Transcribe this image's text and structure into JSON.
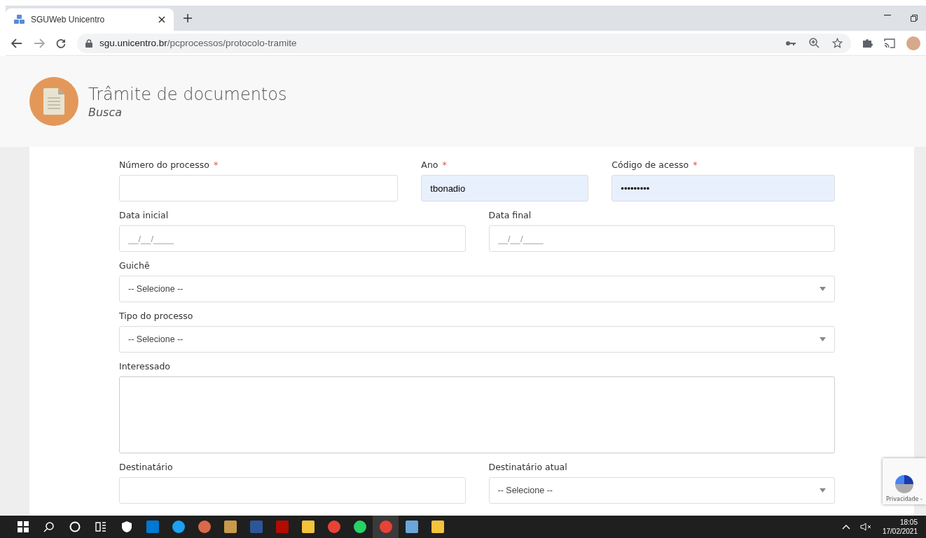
{
  "browser": {
    "tab_title": "SGUWeb Unicentro",
    "url_host": "sgu.unicentro.br",
    "url_path": "/pcprocessos/protocolo-tramite"
  },
  "header": {
    "title": "Trâmite de documentos",
    "subtitle": "Busca"
  },
  "form_rows": [
    [
      {
        "kind": "input",
        "label": "Número do processo",
        "required_mark": "*",
        "autofilled": false
      },
      {
        "kind": "input",
        "label": "Ano",
        "required_mark": "*",
        "value": "tbonadio",
        "autofilled": true
      },
      {
        "kind": "input",
        "label": "Código de acesso",
        "required_mark": "*",
        "value": "•••••••••",
        "autofilled": true
      }
    ],
    [
      {
        "kind": "input",
        "label": "Data inicial",
        "placeholder": "__/__/____",
        "autofilled": false
      },
      {
        "kind": "input",
        "label": "Data final",
        "placeholder": "__/__/____",
        "autofilled": false
      }
    ],
    [
      {
        "kind": "select",
        "label": "Guichê",
        "value": "-- Selecione --"
      }
    ],
    [
      {
        "kind": "select",
        "label": "Tipo do processo",
        "value": "-- Selecione --"
      }
    ],
    [
      {
        "kind": "textarea",
        "label": "Interessado"
      }
    ],
    [
      {
        "kind": "input",
        "label": "Destinatário",
        "autofilled": false
      },
      {
        "kind": "select",
        "label": "Destinatário atual",
        "value": "-- Selecione --"
      }
    ]
  ],
  "recaptcha": {
    "text": "Privacidade -"
  },
  "taskbar": {
    "time": "18:05",
    "date": "17/02/2021"
  }
}
